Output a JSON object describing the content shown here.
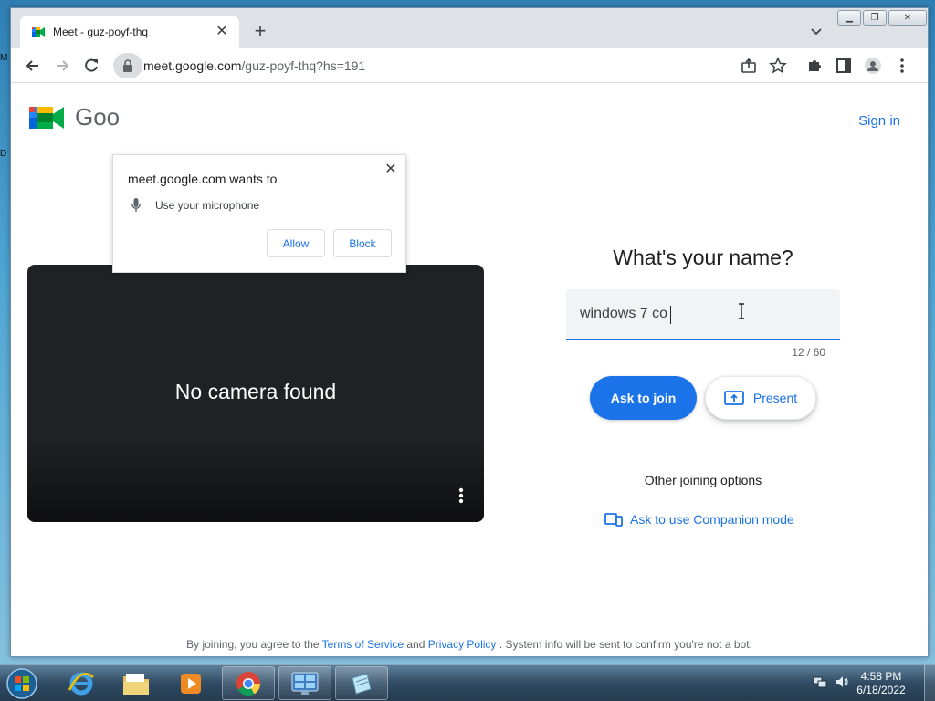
{
  "desktop": {
    "edge_marks": [
      "M",
      "D"
    ]
  },
  "browser": {
    "tab": {
      "title": "Meet - guz-poyf-thq"
    },
    "url": {
      "host": "meet.google.com",
      "path": "/guz-poyf-thq?hs=191"
    }
  },
  "permission_popup": {
    "title": "meet.google.com wants to",
    "request": "Use your microphone",
    "allow_label": "Allow",
    "block_label": "Block"
  },
  "meet": {
    "brand_partial": "Goo",
    "sign_in": "Sign in",
    "camera_message": "No camera found",
    "name_prompt": "What's your name?",
    "name_value": "windows 7 co",
    "char_count": "12 / 60",
    "ask_to_join": "Ask to join",
    "present": "Present",
    "other_options": "Other joining options",
    "companion_mode": "Ask to use Companion mode",
    "footer": {
      "prefix": "By joining, you agree to the",
      "terms": "Terms of Service",
      "and": "and",
      "privacy": "Privacy Policy",
      "suffix": ". System info will be sent to confirm you're not a bot."
    }
  },
  "taskbar": {
    "clock_time": "4:58 PM",
    "clock_date": "6/18/2022"
  },
  "colors": {
    "accent": "#1a73e8",
    "video_bg": "#202124"
  }
}
